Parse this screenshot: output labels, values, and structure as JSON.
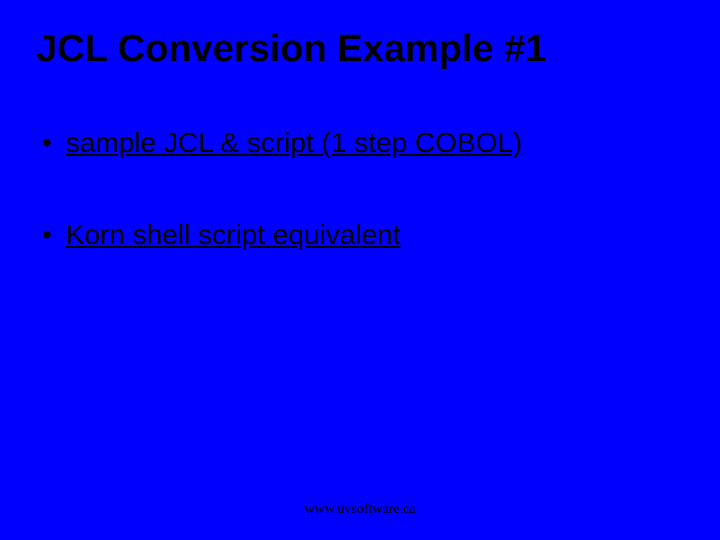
{
  "slide": {
    "title": "JCL Conversion Example #1",
    "bullets": [
      {
        "text": "sample JCL & script (1 step COBOL)"
      },
      {
        "text": "Korn shell script equivalent"
      }
    ],
    "footer": "www.uvsoftware.ca"
  }
}
